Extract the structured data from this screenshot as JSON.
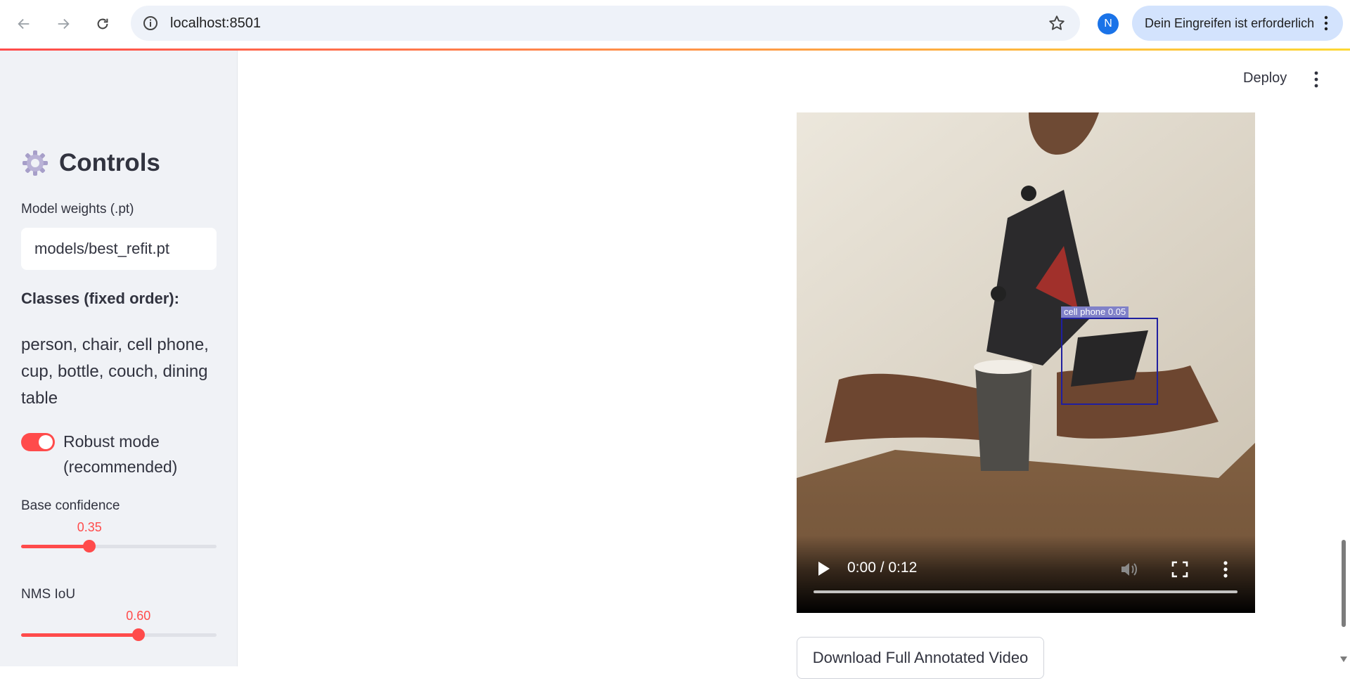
{
  "browser": {
    "url": "localhost:8501",
    "profile_initial": "N",
    "attention_chip": "Dein Eingreifen ist erforderlich",
    "icons": [
      "back-icon",
      "forward-icon",
      "reload-icon",
      "info-icon",
      "star-icon",
      "menu-dots-icon"
    ]
  },
  "sidebar": {
    "title": "Controls",
    "title_icon": "gear-icon",
    "model_weights_label": "Model weights (.pt)",
    "model_weights_value": "models/best_refit.pt",
    "classes_heading": "Classes (fixed order):",
    "classes_text": "person, chair, cell phone, cup, bottle, couch, dining table",
    "robust_mode_label": "Robust mode (recommended)",
    "robust_mode_on": true,
    "base_confidence": {
      "label": "Base confidence",
      "value": "0.35",
      "fraction": 0.35
    },
    "nms_iou": {
      "label": "NMS IoU",
      "value": "0.60",
      "fraction": 0.6
    }
  },
  "header": {
    "deploy_label": "Deploy"
  },
  "video": {
    "detection_label": "cell phone  0.05",
    "time": "0:00 / 0:12",
    "progress": 0.0
  },
  "download_button": "Download Full Annotated Video",
  "colors": {
    "accent": "#ff4b4b",
    "sidebar_bg": "#f0f2f6",
    "detection_box": "#1f1fa0"
  }
}
